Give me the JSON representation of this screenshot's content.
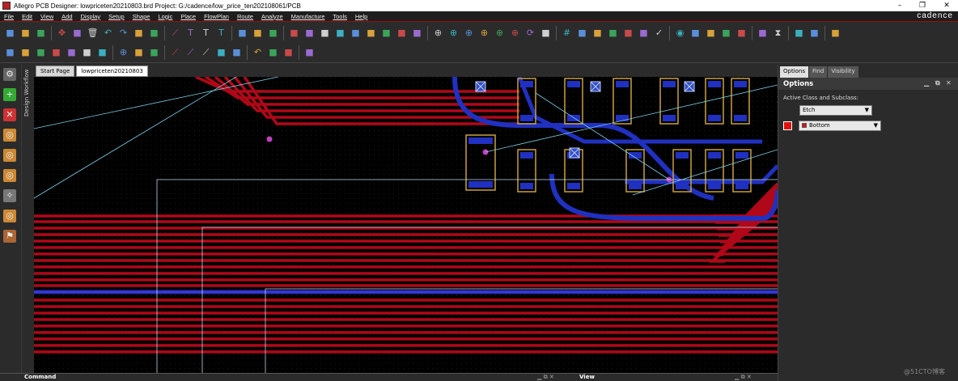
{
  "window": {
    "title": "Allegro PCB Designer: lowpriceten20210803.brd  Project: G:/cadence/low_price_ten202108061/PCB",
    "minimize": "–",
    "maximize": "❐",
    "close": "✕"
  },
  "menu": {
    "items": [
      "File",
      "Edit",
      "View",
      "Add",
      "Display",
      "Setup",
      "Shape",
      "Logic",
      "Place",
      "FlowPlan",
      "Route",
      "Analyze",
      "Manufacture",
      "Tools",
      "Help"
    ],
    "brand": "cadence"
  },
  "workflow_label": "Design Workflow",
  "tabs": [
    {
      "label": "Start Page"
    },
    {
      "label": "lowpriceten20210803"
    }
  ],
  "right_panel": {
    "tabs": [
      "Options",
      "Find",
      "Visibility"
    ],
    "title": "Options",
    "active_label": "Active Class and Subclass:",
    "class_value": "Etch",
    "subclass_value": "Bottom",
    "subclass_color": "#e01010"
  },
  "bottom_panels": {
    "command": "Command",
    "view": "View"
  },
  "colors": {
    "trace": "#b00818",
    "bottom_trace": "#2030c0",
    "pad": "#c8a040",
    "ratsnest": "#7fd0e8",
    "accent": "#9a1010"
  },
  "icons": {
    "toolbar1": [
      "new-icon",
      "open-icon",
      "save-icon",
      "move-icon",
      "copy-icon",
      "delete-icon",
      "undo-icon",
      "redo-icon",
      "pin-icon",
      "unpin-icon",
      "add-line-icon",
      "text-icon",
      "text-edit-icon",
      "text-box-icon",
      "package-icon",
      "component-icon",
      "ic-icon",
      "connect-icon",
      "slide-icon",
      "delay-tune-icon",
      "fanout-icon",
      "custom-smooth-icon",
      "spread-icon",
      "swap-icon",
      "unrats-icon",
      "rats-icon",
      "zoom-fit-icon",
      "zoom-in-icon",
      "zoom-out-icon",
      "zoom-world-icon",
      "zoom-prev-icon",
      "zoom-center-icon",
      "refresh-icon",
      "shape-icon",
      "grid-icon",
      "color-icon",
      "layers-icon",
      "3d-icon",
      "report-icon",
      "database-icon",
      "check-icon",
      "visibility-icon",
      "info-icon",
      "measure-icon",
      "highlight-icon",
      "dehighlight-icon",
      "net-icon",
      "hourglass-icon",
      "place-icon",
      "dims-icon",
      "output-icon"
    ],
    "toolbar2": [
      "ix-icon",
      "iy-icon",
      "snap-icon",
      "align-icon",
      "waveform-icon",
      "slot-icon",
      "frame-icon",
      "zoom-window-icon",
      "spacing-icon",
      "distribute-icon",
      "line-icon",
      "bend-icon",
      "miter-icon",
      "arc-icon",
      "smooth-icon",
      "undo-route-icon",
      "drc-icon",
      "rule-icon",
      "antenna-icon"
    ]
  }
}
